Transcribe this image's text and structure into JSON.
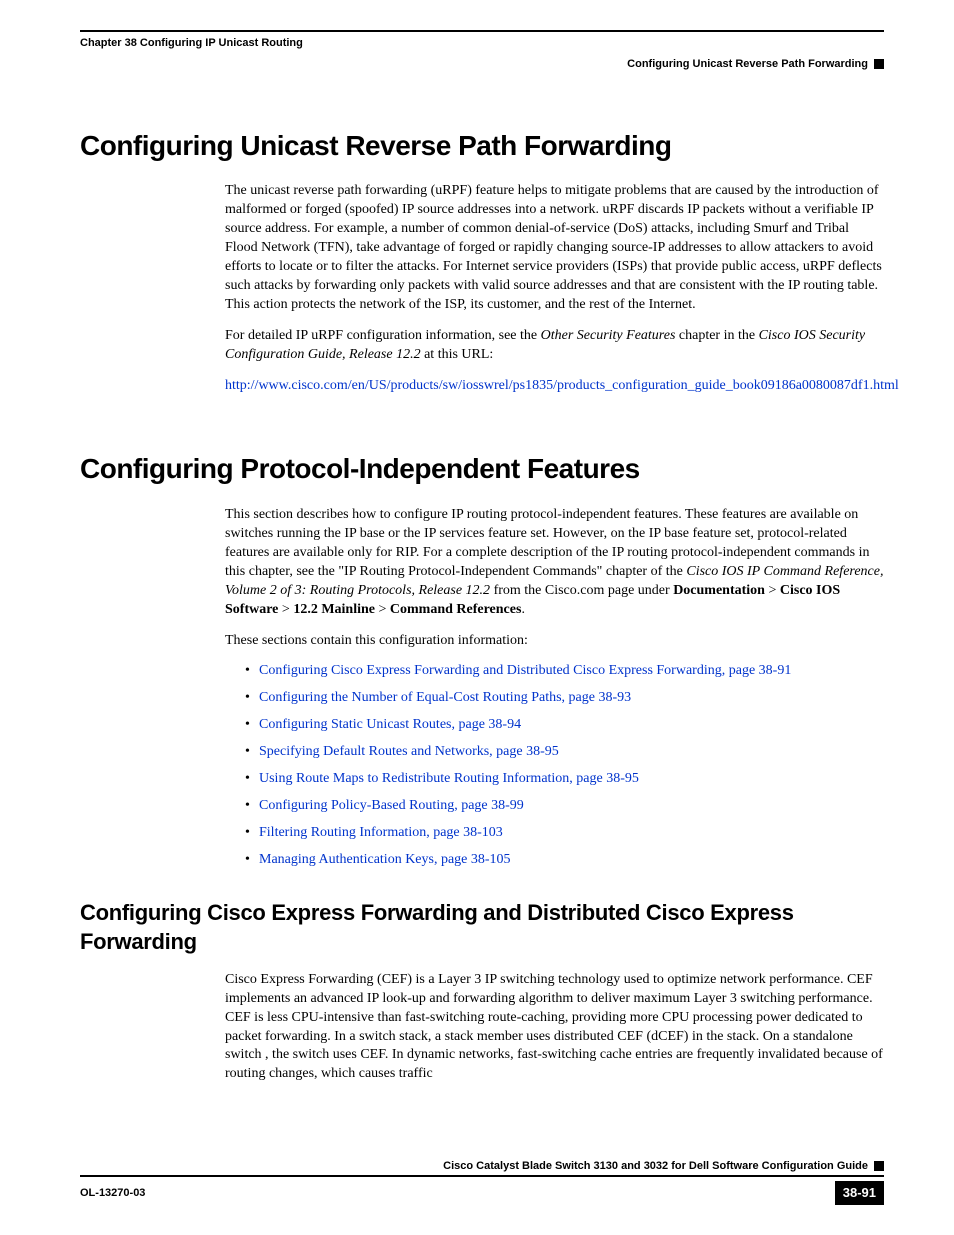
{
  "header": {
    "left": "Chapter 38    Configuring IP Unicast Routing",
    "right": "Configuring Unicast Reverse Path Forwarding"
  },
  "section1": {
    "heading": "Configuring Unicast Reverse Path Forwarding",
    "para1": "The unicast reverse path forwarding (uRPF) feature helps to mitigate problems that are caused by the introduction of malformed or forged (spoofed) IP source addresses into a network. uRPF discards IP packets without a verifiable IP source address. For example, a number of common denial-of-service (DoS) attacks, including Smurf and Tribal Flood Network (TFN), take advantage of forged or rapidly changing source-IP addresses to allow attackers to avoid efforts to locate or to filter the attacks. For Internet service providers (ISPs) that provide public access, uRPF deflects such attacks by forwarding only packets with valid source addresses and that are consistent with the IP routing table. This action protects the network of the ISP, its customer, and the rest of the Internet.",
    "para2_a": "For detailed IP uRPF configuration information, see the ",
    "para2_i1": "Other Security Features",
    "para2_b": " chapter in the ",
    "para2_i2": "Cisco IOS Security Configuration Guide, Release 12.2",
    "para2_c": " at this URL:",
    "link": "http://www.cisco.com/en/US/products/sw/iosswrel/ps1835/products_configuration_guide_book09186a0080087df1.html"
  },
  "section2": {
    "heading": "Configuring Protocol-Independent Features",
    "para1_a": "This section describes how to configure IP routing protocol-independent features. These features are available on switches running the IP base or the IP services feature set. However, on the IP base feature set, protocol-related features are available only for RIP. For a complete description of the IP routing protocol-independent commands in this chapter, see the \"IP Routing Protocol-Independent Commands\" chapter of the ",
    "para1_i": "Cisco IOS IP Command Reference, Volume 2 of 3: Routing Protocols, Release  12.2 ",
    "para1_b": "from the Cisco.com page under ",
    "para1_bold1": "Documentation",
    "para1_gt1": " > ",
    "para1_bold2": "Cisco IOS Software",
    "para1_gt2": " > ",
    "para1_bold3": "12.2 Mainline",
    "para1_gt3": " > ",
    "para1_bold4": "Command References",
    "para1_end": ".",
    "para2": "These sections contain this configuration information:",
    "bullets": [
      "Configuring Cisco Express Forwarding and Distributed Cisco Express Forwarding, page 38-91",
      "Configuring the Number of Equal-Cost Routing Paths, page 38-93",
      "Configuring Static Unicast Routes, page 38-94",
      "Specifying Default Routes and Networks, page 38-95",
      "Using Route Maps to Redistribute Routing Information, page 38-95",
      "Configuring Policy-Based Routing, page 38-99",
      "Filtering Routing Information, page 38-103",
      "Managing Authentication Keys, page 38-105"
    ]
  },
  "section3": {
    "heading": "Configuring Cisco Express Forwarding and Distributed Cisco Express Forwarding",
    "para1": "Cisco Express Forwarding (CEF) is a Layer 3 IP switching technology used to optimize network performance. CEF implements an advanced IP look-up and forwarding algorithm to deliver maximum Layer 3 switching performance. CEF is less CPU-intensive than fast-switching route-caching, providing more CPU processing power dedicated to packet forwarding. In a  switch stack, a stack member uses distributed CEF (dCEF) in the stack. On a standalone switch , the switch uses CEF. In dynamic networks, fast-switching cache entries are frequently invalidated because of routing changes, which causes traffic"
  },
  "footer": {
    "title": "Cisco Catalyst Blade Switch 3130 and 3032 for Dell Software Configuration Guide",
    "left": "OL-13270-03",
    "page": "38-91"
  }
}
